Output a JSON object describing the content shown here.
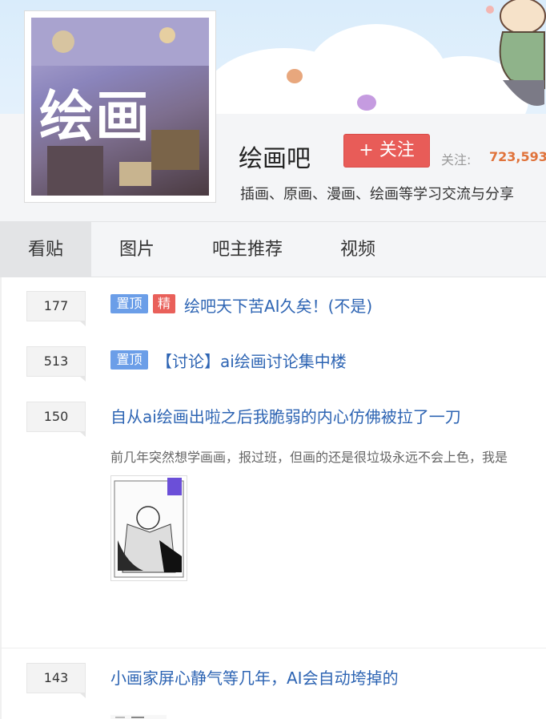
{
  "forum": {
    "name": "绘画吧",
    "follow_button": "+ 关注",
    "follow_label": "关注:",
    "follow_count": "723,593",
    "description": "插画、原画、漫画、绘画等学习交流与分享",
    "avatar_text": "绘画"
  },
  "tabs": [
    {
      "label": "看贴",
      "active": true
    },
    {
      "label": "图片",
      "active": false
    },
    {
      "label": "吧主推荐",
      "active": false
    },
    {
      "label": "视频",
      "active": false
    }
  ],
  "threads": [
    {
      "replies": "177",
      "badges": [
        "置顶",
        "精"
      ],
      "title": "绘吧天下苦AI久矣！(不是)"
    },
    {
      "replies": "513",
      "badges": [
        "置顶"
      ],
      "title": "【讨论】ai绘画讨论集中楼"
    },
    {
      "replies": "150",
      "badges": [],
      "title": "自从ai绘画出啦之后我脆弱的内心仿佛被拉了一刀",
      "excerpt": "前几年突然想学画画，报过班，但画的还是很垃圾永远不会上色，我是"
    },
    {
      "replies": "143",
      "badges": [],
      "title": "小画家屏心静气等几年，AI会自动垮掉的"
    }
  ],
  "colors": {
    "accent": "#e85c58",
    "link": "#2d64b3",
    "count": "#e0733b",
    "pin_badge": "#6b9ee8"
  }
}
